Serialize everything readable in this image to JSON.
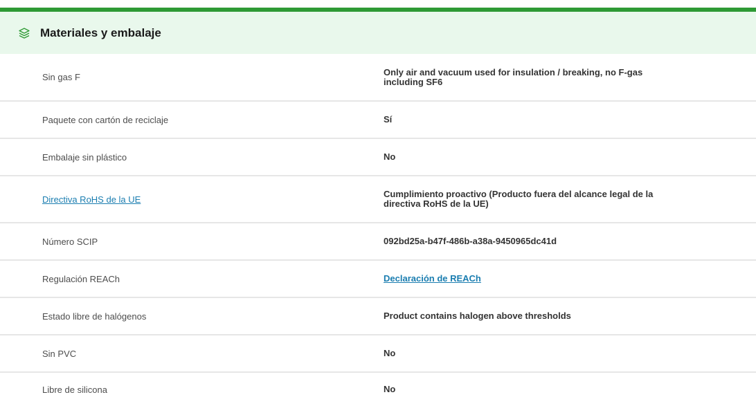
{
  "section": {
    "title": "Materiales y embalaje",
    "icon": "layers-icon",
    "accent_color": "#2e9a35",
    "header_bg": "#e9f8ec"
  },
  "rows": [
    {
      "label": "Sin gas F",
      "value": "Only air and vacuum used for insulation / breaking, no F-gas including SF6",
      "label_link": false,
      "value_link": false
    },
    {
      "label": "Paquete con cartón de reciclaje",
      "value": "Sí",
      "label_link": false,
      "value_link": false
    },
    {
      "label": "Embalaje sin plástico",
      "value": "No",
      "label_link": false,
      "value_link": false
    },
    {
      "label": "Directiva RoHS de la UE",
      "value": "Cumplimiento proactivo (Producto fuera del alcance legal de la directiva RoHS de la UE)",
      "label_link": true,
      "value_link": false
    },
    {
      "label": "Número SCIP",
      "value": "092bd25a-b47f-486b-a38a-9450965dc41d",
      "label_link": false,
      "value_link": false
    },
    {
      "label": "Regulación REACh",
      "value": "Declaración de REACh",
      "label_link": false,
      "value_link": true
    },
    {
      "label": "Estado libre de halógenos",
      "value": "Product contains halogen above thresholds",
      "label_link": false,
      "value_link": false
    },
    {
      "label": "Sin PVC",
      "value": "No",
      "label_link": false,
      "value_link": false
    },
    {
      "label": "Libre de silicona",
      "value": "No",
      "label_link": false,
      "value_link": false
    }
  ],
  "link_color": "#1a7db0"
}
